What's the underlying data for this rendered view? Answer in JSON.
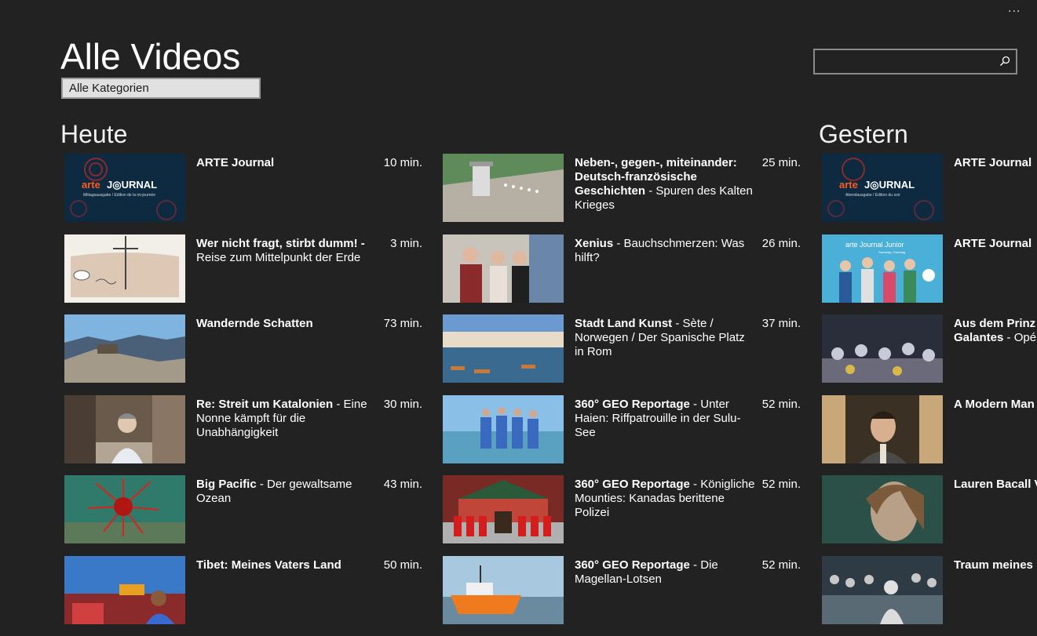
{
  "header": {
    "more_label": "...",
    "title": "Alle Videos",
    "category": "Alle Kategorien",
    "search_placeholder": ""
  },
  "sections": [
    {
      "title": "Heute",
      "items": [
        {
          "title": "ARTE Journal",
          "subtitle": "",
          "duration": "10 min.",
          "thumb": "arte-journal"
        },
        {
          "title": "Wer nicht fragt, stirbt dumm! -",
          "subtitle": "Reise zum Mittelpunkt der Erde",
          "duration": "3 min.",
          "thumb": "drawing"
        },
        {
          "title": "Wandernde Schatten",
          "subtitle": "",
          "duration": "73 min.",
          "thumb": "mountain"
        },
        {
          "title": "Re: Streit um Katalonien",
          "subtitle": "Eine Nonne kämpft für die Unabhängigkeit",
          "duration": "30 min.",
          "thumb": "street"
        },
        {
          "title": "Big Pacific",
          "subtitle": "Der gewaltsame Ozean",
          "duration": "43 min.",
          "thumb": "urchin"
        },
        {
          "title": "Tibet: Meines Vaters Land",
          "subtitle": "",
          "duration": "50 min.",
          "thumb": "tibet"
        }
      ]
    },
    {
      "title": "",
      "items": [
        {
          "title": "Neben-, gegen-, miteinander: Deutsch-französische Geschichten",
          "subtitle": "Spuren des Kalten Krieges",
          "duration": "25 min.",
          "thumb": "tower"
        },
        {
          "title": "Xenius",
          "subtitle": "Bauchschmerzen: Was hilft?",
          "duration": "26 min.",
          "thumb": "people"
        },
        {
          "title": "Stadt Land Kunst",
          "subtitle": "Sète / Norwegen / Der Spanische Platz in Rom",
          "duration": "37 min.",
          "thumb": "canal"
        },
        {
          "title": "360° GEO Reportage",
          "subtitle": "Unter Haien: Riffpatrouille in der Sulu-See",
          "duration": "52 min.",
          "thumb": "beach"
        },
        {
          "title": "360° GEO Reportage",
          "subtitle": "Königliche Mounties: Kanadas berittene Polizei",
          "duration": "52 min.",
          "thumb": "mounties"
        },
        {
          "title": "360° GEO Reportage",
          "subtitle": "Die Magellan-Lotsen",
          "duration": "52 min.",
          "thumb": "boat"
        }
      ]
    },
    {
      "title": "Gestern",
      "items": [
        {
          "title": "ARTE Journal",
          "subtitle": "",
          "duration": "",
          "thumb": "arte-journal-soir"
        },
        {
          "title": "ARTE Journal",
          "subtitle": "",
          "duration": "",
          "thumb": "journal-junior"
        },
        {
          "title": "Aus dem Prinz in München: L Galantes",
          "subtitle": "Opé Aufzügen mit ei",
          "duration": "",
          "thumb": "opera"
        },
        {
          "title": "A Modern Man",
          "subtitle": "",
          "duration": "",
          "thumb": "man"
        },
        {
          "title": "Lauren Bacall Verführerin",
          "subtitle": "",
          "duration": "",
          "thumb": "woman"
        },
        {
          "title": "Traum meines",
          "subtitle": "",
          "duration": "",
          "thumb": "vintage"
        }
      ]
    }
  ],
  "thumb_text": {
    "logo_prefix": "arte",
    "logo_main": "J◎URNAL",
    "mittag": "Mittagsausgabe / Edition de la mi-journée",
    "soir": "Abendausgabe / Edition du soir",
    "junior": "arte Journal Junior",
    "junior_sub": "Samstag / Sonntag"
  }
}
